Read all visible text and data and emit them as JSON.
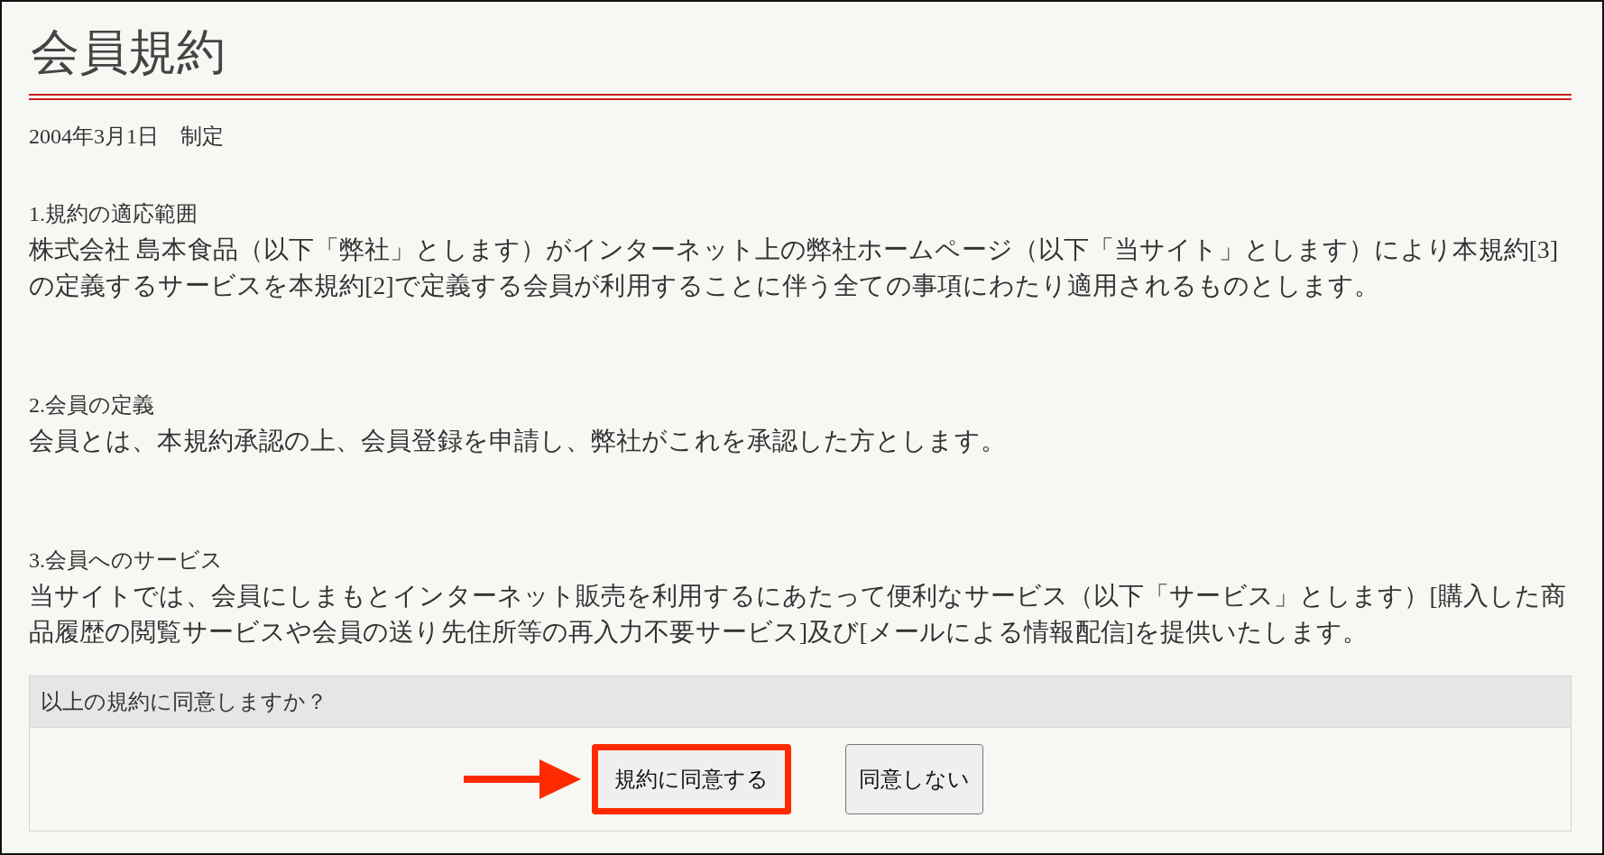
{
  "title": "会員規約",
  "enacted": "2004年3月1日　制定",
  "sections": [
    {
      "heading": "1.規約の適応範囲",
      "body": "株式会社 島本食品（以下「弊社」とします）がインターネット上の弊社ホームページ（以下「当サイト」とします）により本規約[3]の定義するサービスを本規約[2]で定義する会員が利用することに伴う全ての事項にわたり適用されるものとします。"
    },
    {
      "heading": "2.会員の定義",
      "body": "会員とは、本規約承認の上、会員登録を申請し、弊社がこれを承認した方とします。"
    },
    {
      "heading": "3.会員へのサービス",
      "body": "当サイトでは、会員にしまもとインターネット販売を利用するにあたって便利なサービス（以下「サービス」とします）[購入した商品履歴の閲覧サービスや会員の送り先住所等の再入力不要サービス]及び[メールによる情報配信]を提供いたします。"
    }
  ],
  "consent": {
    "question": "以上の規約に同意しますか？",
    "buttons": [
      {
        "label": "規約に同意する",
        "highlighted": true
      },
      {
        "label": "同意しない",
        "highlighted": false
      }
    ]
  }
}
